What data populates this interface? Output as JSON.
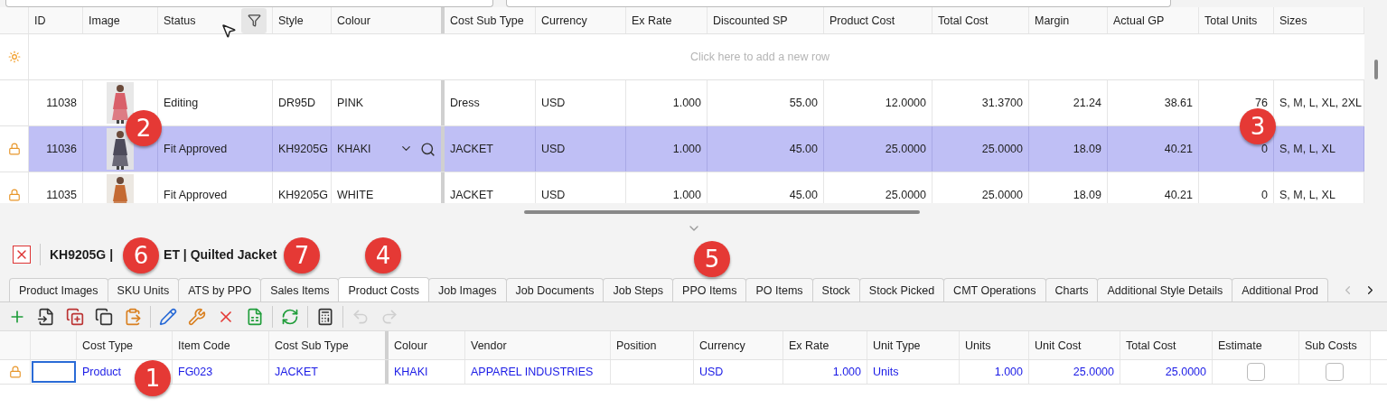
{
  "grid": {
    "columns": [
      {
        "label": "ID",
        "kind": "number"
      },
      {
        "label": "Image",
        "kind": "picture"
      },
      {
        "label": "Status",
        "kind": "text",
        "filter": true
      },
      {
        "label": "Style",
        "kind": "text"
      },
      {
        "label": "Colour",
        "kind": "lookup"
      },
      {
        "label": "Cost Sub Type",
        "kind": "text"
      },
      {
        "label": "Currency",
        "kind": "text"
      },
      {
        "label": "Ex Rate",
        "kind": "number"
      },
      {
        "label": "Discounted SP",
        "kind": "number"
      },
      {
        "label": "Product Cost",
        "kind": "number"
      },
      {
        "label": "Total Cost",
        "kind": "number"
      },
      {
        "label": "Margin",
        "kind": "number"
      },
      {
        "label": "Actual GP",
        "kind": "number"
      },
      {
        "label": "Total Units",
        "kind": "number"
      },
      {
        "label": "Sizes",
        "kind": "text"
      }
    ],
    "new_row": "Click here to add a new row",
    "rows": [
      {
        "locked": false,
        "selected": false,
        "cells": [
          "11038",
          "",
          "Editing",
          "DR95D",
          "PINK",
          "Dress",
          "USD",
          "1.000",
          "55.00",
          "12.0000",
          "31.3700",
          "21.24",
          "38.61",
          "76",
          "S, M, L, XL, 2XL"
        ]
      },
      {
        "locked": true,
        "selected": true,
        "cells": [
          "11036",
          "",
          "Fit Approved",
          "KH9205G",
          "KHAKI",
          "JACKET",
          "USD",
          "1.000",
          "45.00",
          "25.0000",
          "25.0000",
          "18.09",
          "40.21",
          "0",
          "S, M, L, XL"
        ]
      },
      {
        "locked": true,
        "selected": false,
        "cells": [
          "11035",
          "",
          "Fit Approved",
          "KH9205G",
          "WHITE",
          "JACKET",
          "USD",
          "1.000",
          "45.00",
          "25.0000",
          "25.0000",
          "18.09",
          "40.21",
          "0",
          "S, M, L, XL"
        ]
      }
    ]
  },
  "detail": {
    "title_parts": [
      "KH9205G |",
      "ET | Quilted Jacket"
    ],
    "tabs": [
      {
        "label": "Product Images",
        "selected": false
      },
      {
        "label": "SKU Units",
        "selected": false
      },
      {
        "label": "ATS by PPO",
        "selected": false
      },
      {
        "label": "Sales Items",
        "selected": false
      },
      {
        "label": "Product Costs",
        "selected": true
      },
      {
        "label": "Job Images",
        "selected": false
      },
      {
        "label": "Job Documents",
        "selected": false
      },
      {
        "label": "Job Steps",
        "selected": false
      },
      {
        "label": "PPO Items",
        "selected": false
      },
      {
        "label": "PO Items",
        "selected": false
      },
      {
        "label": "Stock",
        "selected": false
      },
      {
        "label": "Stock Picked",
        "selected": false
      },
      {
        "label": "CMT Operations",
        "selected": false
      },
      {
        "label": "Charts",
        "selected": false
      },
      {
        "label": "Additional Style Details",
        "selected": false
      },
      {
        "label": "Additional Prod",
        "selected": false
      }
    ],
    "toolbar": [
      {
        "kind": "add",
        "disabled": false
      },
      {
        "kind": "copy-in",
        "disabled": false
      },
      {
        "kind": "copy-out",
        "disabled": false
      },
      {
        "kind": "copy",
        "disabled": false
      },
      {
        "kind": "paste",
        "disabled": false
      },
      {
        "kind": "separator"
      },
      {
        "kind": "edit",
        "disabled": false
      },
      {
        "kind": "configure",
        "disabled": false
      },
      {
        "kind": "delete",
        "disabled": false
      },
      {
        "kind": "excel",
        "disabled": false
      },
      {
        "kind": "separator"
      },
      {
        "kind": "refresh",
        "disabled": false
      },
      {
        "kind": "separator"
      },
      {
        "kind": "calculator",
        "disabled": false
      },
      {
        "kind": "separator"
      },
      {
        "kind": "undo",
        "disabled": true
      },
      {
        "kind": "redo",
        "disabled": true
      }
    ],
    "columns": [
      {
        "label": "Cost Type",
        "kind": "text"
      },
      {
        "label": "Item Code",
        "kind": "text"
      },
      {
        "label": "Cost Sub Type",
        "kind": "text"
      },
      {
        "label": "Colour",
        "kind": "text"
      },
      {
        "label": "Vendor",
        "kind": "text"
      },
      {
        "label": "Position",
        "kind": "text"
      },
      {
        "label": "Currency",
        "kind": "text"
      },
      {
        "label": "Ex Rate",
        "kind": "number"
      },
      {
        "label": "Unit Type",
        "kind": "text"
      },
      {
        "label": "Units",
        "kind": "number"
      },
      {
        "label": "Unit Cost",
        "kind": "number"
      },
      {
        "label": "Total Cost",
        "kind": "number"
      },
      {
        "label": "Estimate",
        "kind": "check"
      },
      {
        "label": "Sub Costs",
        "kind": "check"
      }
    ],
    "rows": [
      {
        "locked": true,
        "cells": [
          "Product",
          "FG023",
          "JACKET",
          "KHAKI",
          "APPAREL INDUSTRIES",
          "",
          "USD",
          "1.000",
          "Units",
          "1.000",
          "25.0000",
          "25.0000"
        ],
        "estimate": false,
        "sub_costs": false
      }
    ]
  },
  "badges": [
    "2",
    "3",
    "6",
    "7",
    "4",
    "5",
    "1"
  ]
}
